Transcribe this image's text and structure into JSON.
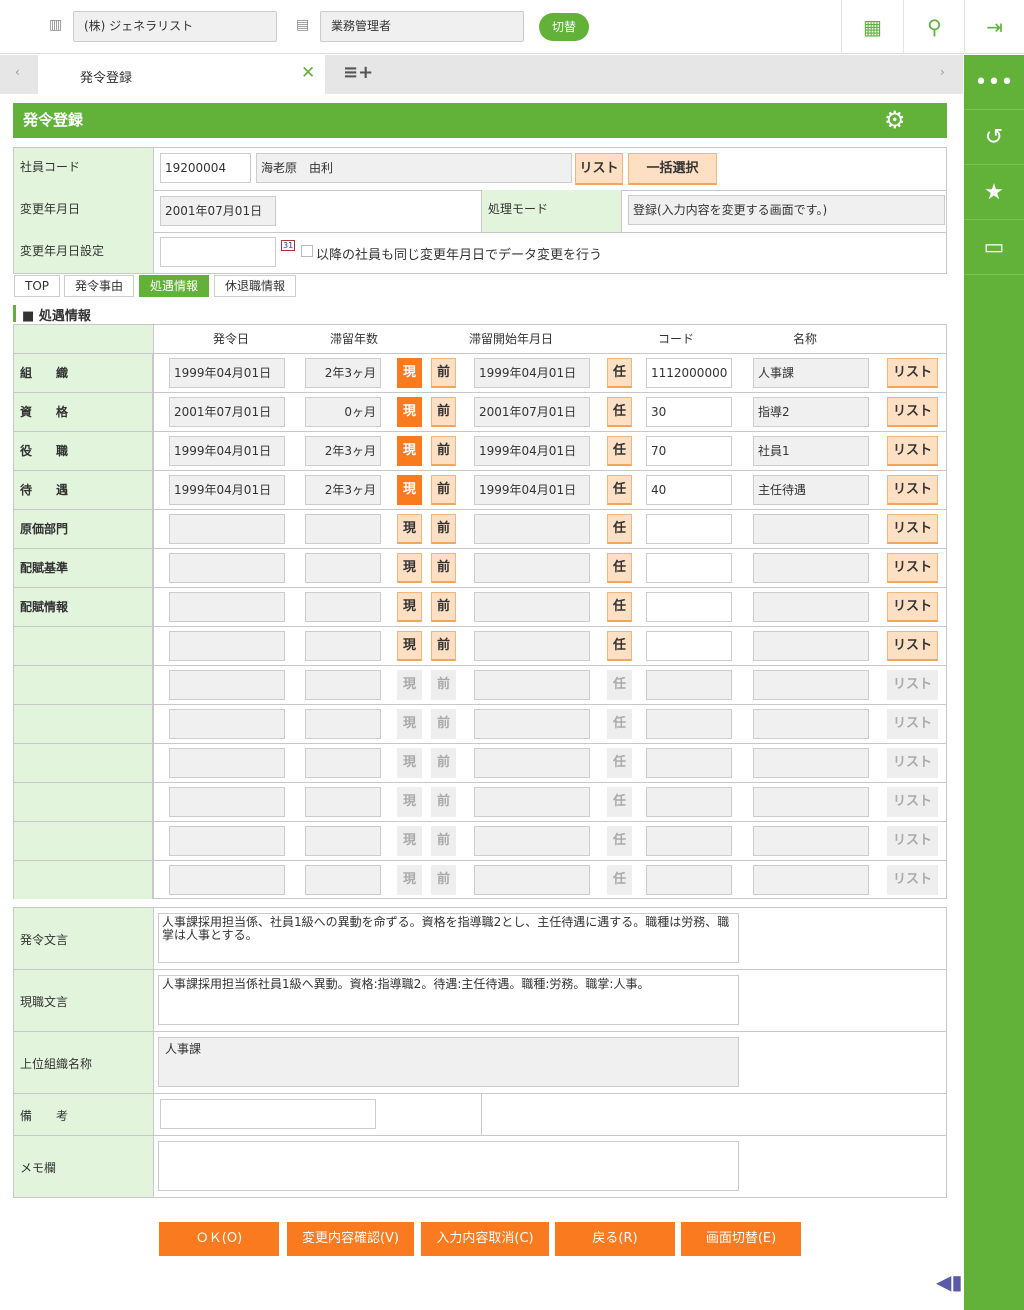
{
  "header": {
    "company": "(株) ジェネラリスト",
    "role": "業務管理者",
    "switch_label": "切替"
  },
  "tabs": {
    "active": "発令登録"
  },
  "page_title": "発令登録",
  "form": {
    "employee_code_label": "社員コード",
    "employee_code": "19200004",
    "employee_name": "海老原　由利",
    "list_label": "リスト",
    "bulk_select_label": "一括選択",
    "change_date_label": "変更年月日",
    "change_date": "2001年07月01日",
    "mode_label": "処理モード",
    "mode_value": "登録(入力内容を変更する画面です。)",
    "change_date_setting_label": "変更年月日設定",
    "change_date_setting": "",
    "calendar_icon_text": "31",
    "same_date_checkbox_label": "以降の社員も同じ変更年月日でデータ変更を行う"
  },
  "section_tabs": [
    "TOP",
    "発令事由",
    "処遇情報",
    "休退職情報"
  ],
  "section_title": "処遇情報",
  "grid": {
    "headers": [
      "発令日",
      "滞留年数",
      "滞留開始年月日",
      "コード",
      "名称"
    ],
    "btn_current": "現",
    "btn_prev": "前",
    "btn_any": "任",
    "btn_list": "リスト",
    "rows": [
      {
        "label": "組　　織",
        "date": "1999年04月01日",
        "years": "2年3ヶ月",
        "start": "1999年04月01日",
        "code": "1112000000",
        "name": "人事課",
        "state": "active"
      },
      {
        "label": "資　　格",
        "date": "2001年07月01日",
        "years": "0ヶ月",
        "start": "2001年07月01日",
        "code": "30",
        "name": "指導2",
        "state": "active"
      },
      {
        "label": "役　　職",
        "date": "1999年04月01日",
        "years": "2年3ヶ月",
        "start": "1999年04月01日",
        "code": "70",
        "name": "社員1",
        "state": "active"
      },
      {
        "label": "待　　遇",
        "date": "1999年04月01日",
        "years": "2年3ヶ月",
        "start": "1999年04月01日",
        "code": "40",
        "name": "主任待遇",
        "state": "active"
      },
      {
        "label": "原価部門",
        "date": "",
        "years": "",
        "start": "",
        "code": "",
        "name": "",
        "state": "enabled"
      },
      {
        "label": "配賦基準",
        "date": "",
        "years": "",
        "start": "",
        "code": "",
        "name": "",
        "state": "enabled"
      },
      {
        "label": "配賦情報",
        "date": "",
        "years": "",
        "start": "",
        "code": "",
        "name": "",
        "state": "enabled"
      },
      {
        "label": "",
        "date": "",
        "years": "",
        "start": "",
        "code": "",
        "name": "",
        "state": "enabled"
      },
      {
        "label": "",
        "date": "",
        "years": "",
        "start": "",
        "code": "",
        "name": "",
        "state": "disabled"
      },
      {
        "label": "",
        "date": "",
        "years": "",
        "start": "",
        "code": "",
        "name": "",
        "state": "disabled"
      },
      {
        "label": "",
        "date": "",
        "years": "",
        "start": "",
        "code": "",
        "name": "",
        "state": "disabled"
      },
      {
        "label": "",
        "date": "",
        "years": "",
        "start": "",
        "code": "",
        "name": "",
        "state": "disabled"
      },
      {
        "label": "",
        "date": "",
        "years": "",
        "start": "",
        "code": "",
        "name": "",
        "state": "disabled"
      },
      {
        "label": "",
        "date": "",
        "years": "",
        "start": "",
        "code": "",
        "name": "",
        "state": "disabled"
      }
    ]
  },
  "texts": {
    "order_text_label": "発令文言",
    "order_text": "人事課採用担当係、社員1級への異動を命ずる。資格を指導職2とし、主任待遇に遇する。職種は労務、職掌は人事とする。",
    "current_text_label": "現職文言",
    "current_text": "人事課採用担当係社員1級へ異動。資格:指導職2。待遇:主任待遇。職種:労務。職掌:人事。",
    "parent_org_label": "上位組織名称",
    "parent_org": "人事課",
    "remarks_label": "備　　考",
    "remarks": "",
    "memo_label": "メモ欄",
    "memo": ""
  },
  "buttons": {
    "ok": "ＯＫ(O)",
    "confirm": "変更内容確認(V)",
    "cancel": "入力内容取消(C)",
    "back": "戻る(R)",
    "switch": "画面切替(E)"
  }
}
